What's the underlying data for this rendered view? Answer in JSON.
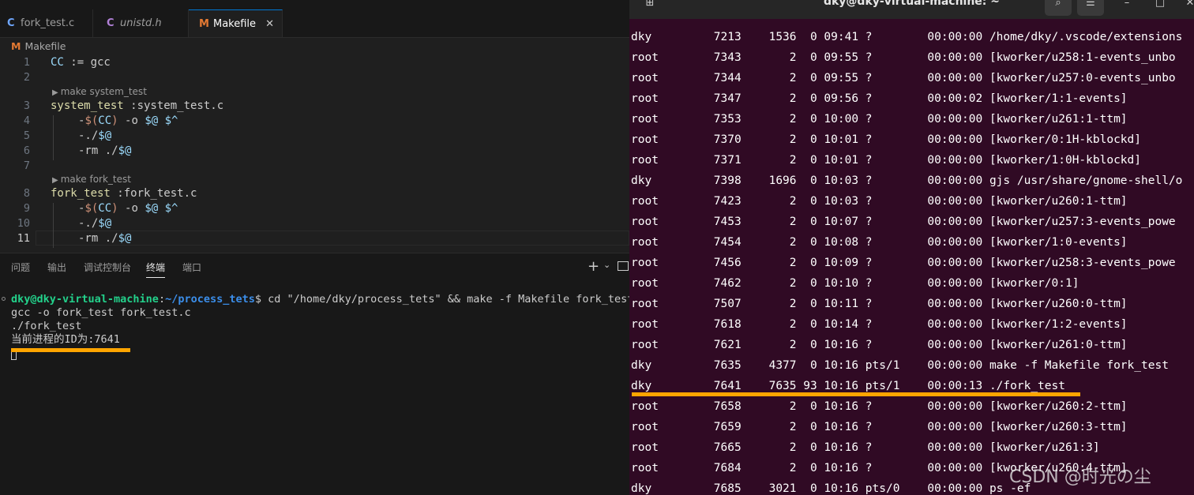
{
  "editor": {
    "tabs": [
      {
        "icon": "C",
        "label": "fork_test.c",
        "active": false
      },
      {
        "icon": "C",
        "label": "unistd.h",
        "active": false
      },
      {
        "icon": "M",
        "label": "Makefile",
        "active": true
      }
    ],
    "tab_close": "✕",
    "breadcrumb": {
      "icon": "M",
      "label": "Makefile"
    },
    "codelens": [
      "make system_test",
      "make fork_test"
    ],
    "line_numbers": [
      "1",
      "2",
      "3",
      "4",
      "5",
      "6",
      "7",
      "8",
      "9",
      "10",
      "11"
    ],
    "code": {
      "cc_var": "CC",
      "assign": " := gcc",
      "target1": "system_test",
      "prereq1": " :system_test.c",
      "target2": "fork_test",
      "prereq2": " :fork_test.c",
      "dash": "-",
      "dollar_open": "$(",
      "cc": "CC",
      "dollar_close": ")",
      "compile_mid": " -o ",
      "auto_at": "$@",
      "space": " ",
      "auto_hat": "$^",
      "run_prefix": "-./",
      "rm_prefix": "-rm ./"
    },
    "panel_tabs": [
      "问题",
      "输出",
      "调试控制台",
      "终端",
      "端口"
    ],
    "panel_active": "终端",
    "panel_plus": "+",
    "panel_chevron": "⌄",
    "terminal": {
      "user_host": "dky@dky-virtual-machine",
      "colon": ":",
      "path": "~/process_tets",
      "prompt_rest": "$ cd \"/home/dky/process_tets\" && make -f Makefile fork_test",
      "line2": "gcc -o fork_test fork_test.c",
      "line3": "./fork_test",
      "line4": "当前进程的ID为:7641"
    }
  },
  "gnome_terminal": {
    "title": "dky@dky-virtual-machine: ~",
    "new_tab_icon": "⊞",
    "search_icon": "⌕",
    "menu_icon": "☰",
    "minimize_icon": "–",
    "maximize_icon": "□",
    "close_icon": "✕",
    "ps_rows": [
      "dky         7213    1536  0 09:41 ?        00:00:00 /home/dky/.vscode/extensions",
      "root        7343       2  0 09:55 ?        00:00:00 [kworker/u258:1-events_unbo",
      "root        7344       2  0 09:55 ?        00:00:00 [kworker/u257:0-events_unbo",
      "root        7347       2  0 09:56 ?        00:00:02 [kworker/1:1-events]",
      "root        7353       2  0 10:00 ?        00:00:00 [kworker/u261:1-ttm]",
      "root        7370       2  0 10:01 ?        00:00:00 [kworker/0:1H-kblockd]",
      "root        7371       2  0 10:01 ?        00:00:00 [kworker/1:0H-kblockd]",
      "dky         7398    1696  0 10:03 ?        00:00:00 gjs /usr/share/gnome-shell/o",
      "root        7423       2  0 10:03 ?        00:00:00 [kworker/u260:1-ttm]",
      "root        7453       2  0 10:07 ?        00:00:00 [kworker/u257:3-events_powe",
      "root        7454       2  0 10:08 ?        00:00:00 [kworker/1:0-events]",
      "root        7456       2  0 10:09 ?        00:00:00 [kworker/u258:3-events_powe",
      "root        7462       2  0 10:10 ?        00:00:00 [kworker/0:1]",
      "root        7507       2  0 10:11 ?        00:00:00 [kworker/u260:0-ttm]",
      "root        7618       2  0 10:14 ?        00:00:00 [kworker/1:2-events]",
      "root        7621       2  0 10:16 ?        00:00:00 [kworker/u261:0-ttm]",
      "dky         7635    4377  0 10:16 pts/1    00:00:00 make -f Makefile fork_test",
      "dky         7641    7635 93 10:16 pts/1    00:00:13 ./fork_test",
      "root        7658       2  0 10:16 ?        00:00:00 [kworker/u260:2-ttm]",
      "root        7659       2  0 10:16 ?        00:00:00 [kworker/u260:3-ttm]",
      "root        7665       2  0 10:16 ?        00:00:00 [kworker/u261:3]",
      "root        7684       2  0 10:16 ?        00:00:00 [kworker/u260:4-ttm]",
      "dky         7685    3021  0 10:16 pts/0    00:00:00 ps -ef"
    ]
  },
  "watermark": "CSDN @时光の尘",
  "colors": {
    "highlight": "#ffa500",
    "terminal_bg": "#300a24",
    "editor_bg": "#1f1f1f"
  }
}
